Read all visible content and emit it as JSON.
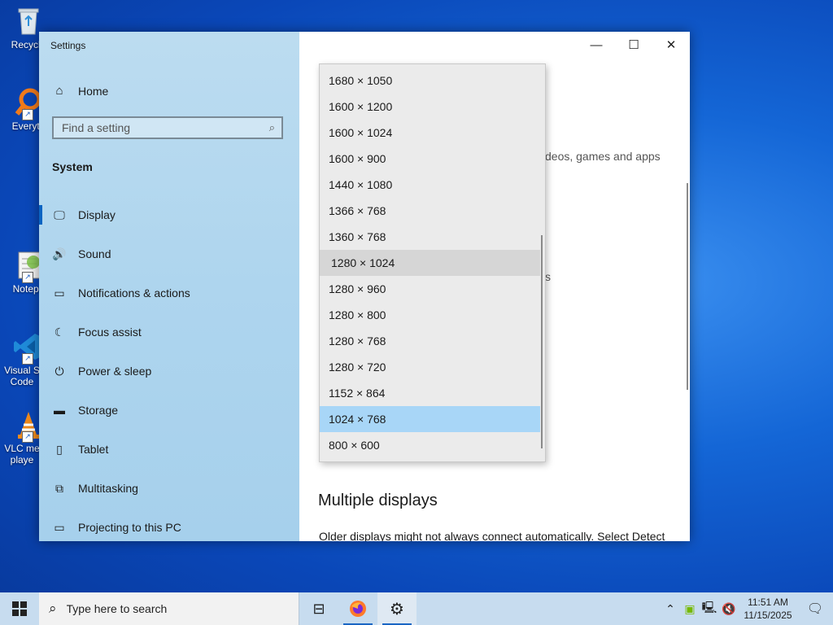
{
  "desktop": {
    "icons": [
      {
        "name": "recycle-bin",
        "label": "Recycle",
        "icon": "recycle-bin-icon"
      },
      {
        "name": "everything",
        "label": "Everyth",
        "icon": "magnifier-icon"
      },
      {
        "name": "notepadpp",
        "label": "Notepa",
        "icon": "notepad-icon"
      },
      {
        "name": "vscode",
        "label": "Visual S Code",
        "icon": "vscode-icon"
      },
      {
        "name": "vlc",
        "label": "VLC me playe",
        "icon": "vlc-cone-icon"
      }
    ]
  },
  "window": {
    "title": "Settings",
    "home_label": "Home",
    "search_placeholder": "Find a setting",
    "section": "System",
    "nav": [
      {
        "label": "Display",
        "icon": "monitor-icon",
        "glyph": "🖵"
      },
      {
        "label": "Sound",
        "icon": "speaker-icon",
        "glyph": "🔊"
      },
      {
        "label": "Notifications & actions",
        "icon": "notification-icon",
        "glyph": "▭"
      },
      {
        "label": "Focus assist",
        "icon": "moon-icon",
        "glyph": "☾"
      },
      {
        "label": "Power & sleep",
        "icon": "power-icon",
        "glyph": "⏻"
      },
      {
        "label": "Storage",
        "icon": "storage-icon",
        "glyph": "▬"
      },
      {
        "label": "Tablet",
        "icon": "tablet-icon",
        "glyph": "▯"
      },
      {
        "label": "Multitasking",
        "icon": "multitasking-icon",
        "glyph": "⧉"
      },
      {
        "label": "Projecting to this PC",
        "icon": "project-icon",
        "glyph": "▭"
      }
    ],
    "controls": {
      "minimize": "—",
      "maximize": "☐",
      "close": "✕"
    },
    "content": {
      "partial_text": "deos, games and apps",
      "partial_char": "s",
      "multiple_displays_heading": "Multiple displays",
      "multiple_displays_text": "Older displays might not always connect automatically. Select Detect"
    }
  },
  "dropdown": {
    "options": [
      "1680 × 1050",
      "1600 × 1200",
      "1600 × 1024",
      "1600 × 900",
      "1440 × 1080",
      "1366 × 768",
      "1360 × 768",
      "1280 × 1024",
      "1280 × 960",
      "1280 × 800",
      "1280 × 768",
      "1280 × 720",
      "1152 × 864",
      "1024 × 768",
      "800 × 600"
    ],
    "hovered": "1280 × 1024",
    "selected": "1024 × 768"
  },
  "taskbar": {
    "search_placeholder": "Type here to search",
    "apps": [
      "task-view-icon",
      "firefox-icon",
      "settings-gear-icon"
    ],
    "time": "11:51 AM",
    "date": "11/15/2025"
  }
}
